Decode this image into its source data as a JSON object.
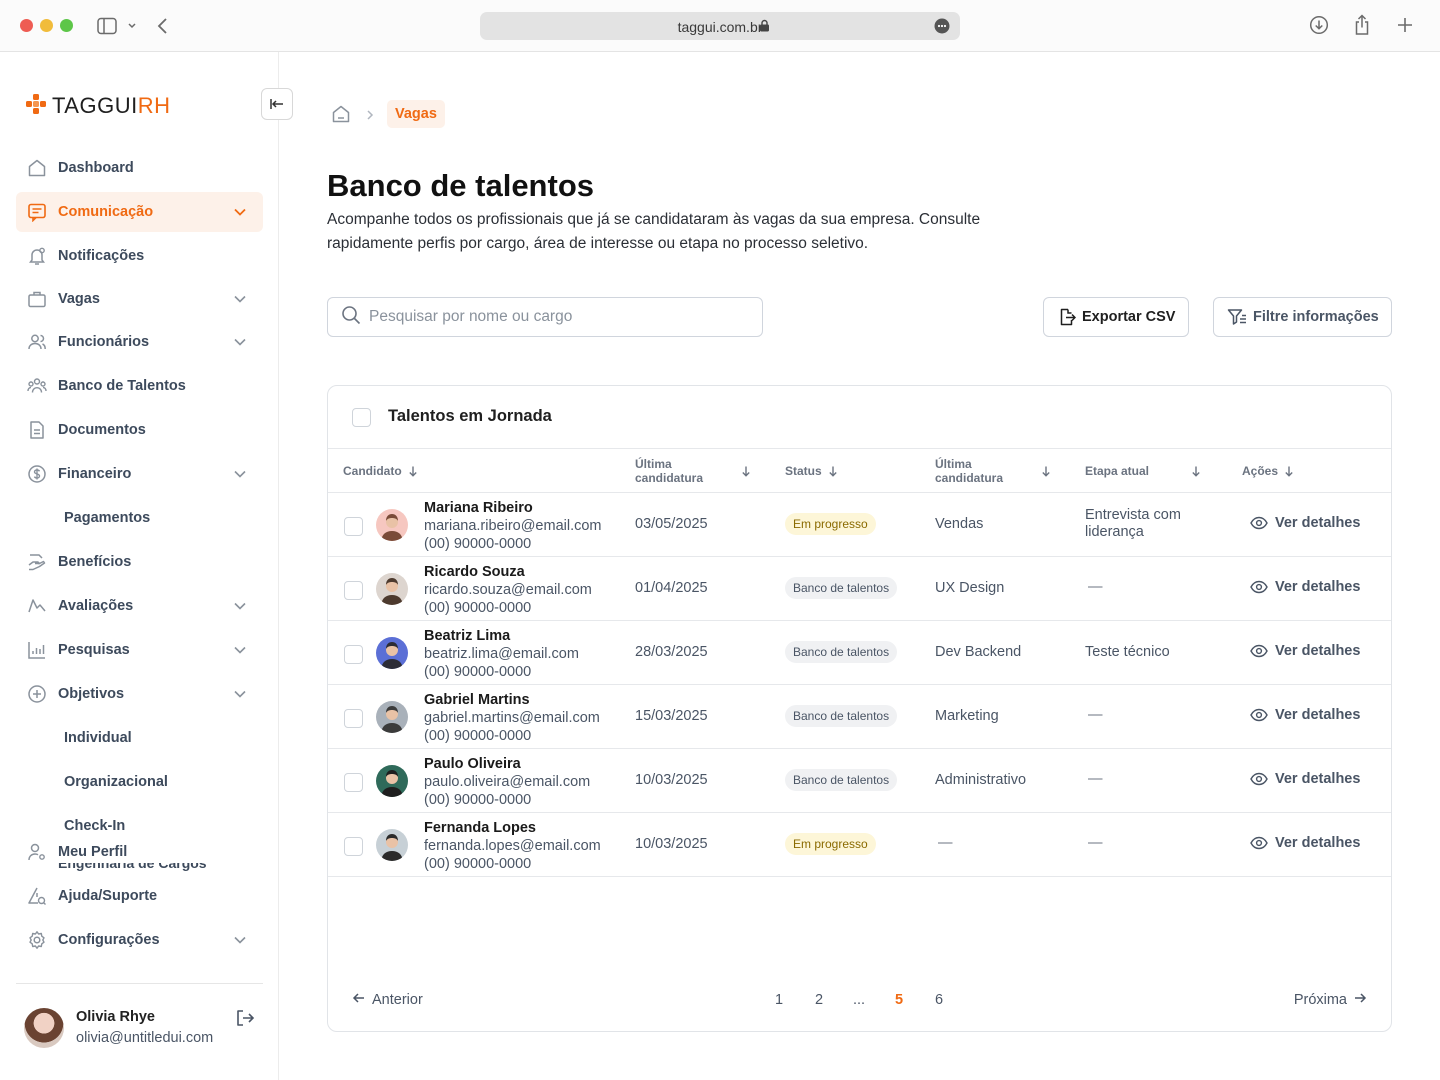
{
  "browser": {
    "url": "taggui.com.br"
  },
  "sidebar": {
    "logo": {
      "text_main": "TAGGUI",
      "text_accent": "RH"
    },
    "items": [
      {
        "label": "Dashboard",
        "icon": "home-icon"
      },
      {
        "label": "Comunicação",
        "icon": "message-icon",
        "active": true
      },
      {
        "label": "Notificações",
        "icon": "bell-icon"
      },
      {
        "label": "Vagas",
        "icon": "briefcase-icon"
      },
      {
        "label": "Funcionários",
        "icon": "users-icon"
      },
      {
        "label": "Banco de Talentos",
        "icon": "talents-icon"
      },
      {
        "label": "Documentos",
        "icon": "document-icon"
      },
      {
        "label": "Financeiro",
        "icon": "dollar-icon"
      },
      {
        "label": "Benefícios",
        "icon": "benefits-icon"
      },
      {
        "label": "Avaliações",
        "icon": "evaluation-icon"
      },
      {
        "label": "Pesquisas",
        "icon": "chart-icon"
      },
      {
        "label": "Objetivos",
        "icon": "target-icon"
      },
      {
        "label": "Meu Perfil",
        "icon": "profile-icon"
      },
      {
        "label": "Ajuda/Suporte",
        "icon": "help-icon"
      },
      {
        "label": "Configurações",
        "icon": "settings-icon"
      }
    ],
    "sub_items": {
      "pagamentos": "Pagamentos",
      "individual": "Individual",
      "organizacional": "Organizacional",
      "checkin": "Check-In"
    },
    "hidden_label": "Engenharia de Cargos",
    "user": {
      "name": "Olivia Rhye",
      "email": "olivia@untitledui.com"
    }
  },
  "breadcrumb": {
    "current": "Vagas"
  },
  "page": {
    "title": "Banco de talentos",
    "description": "Acompanhe todos os profissionais que já se candidataram às vagas da sua empresa. Consulte rapidamente perfis por cargo, área de interesse ou etapa no processo seletivo."
  },
  "search": {
    "placeholder": "Pesquisar por nome ou cargo"
  },
  "toolbar": {
    "export_label": "Exportar CSV",
    "filter_label": "Filtre informações"
  },
  "table": {
    "title": "Talentos em Jornada",
    "columns": {
      "candidate": "Candidato",
      "last_application": "Última candidatura",
      "status": "Status",
      "last_application_2": "Última candidatura",
      "stage": "Etapa atual",
      "actions": "Ações"
    },
    "action_label": "Ver detalhes",
    "rows": [
      {
        "name": "Mariana Ribeiro",
        "email": "mariana.ribeiro@email.com",
        "phone": "(00) 90000-0000",
        "date": "03/05/2025",
        "status": "Em progresso",
        "status_type": "progress",
        "area": "Vendas",
        "stage": "Entrevista com liderança"
      },
      {
        "name": "Ricardo Souza",
        "email": "ricardo.souza@email.com",
        "phone": "(00) 90000-0000",
        "date": "01/04/2025",
        "status": "Banco de talentos",
        "status_type": "bank",
        "area": "UX Design",
        "stage": "—"
      },
      {
        "name": "Beatriz Lima",
        "email": "beatriz.lima@email.com",
        "phone": "(00) 90000-0000",
        "date": "28/03/2025",
        "status": "Banco de talentos",
        "status_type": "bank",
        "area": "Dev Backend",
        "stage": "Teste técnico"
      },
      {
        "name": "Gabriel Martins",
        "email": "gabriel.martins@email.com",
        "phone": "(00) 90000-0000",
        "date": "15/03/2025",
        "status": "Banco de talentos",
        "status_type": "bank",
        "area": "Marketing",
        "stage": "—"
      },
      {
        "name": "Paulo Oliveira",
        "email": "paulo.oliveira@email.com",
        "phone": "(00) 90000-0000",
        "date": "10/03/2025",
        "status": "Banco de talentos",
        "status_type": "bank",
        "area": "Administrativo",
        "stage": "—"
      },
      {
        "name": "Fernanda Lopes",
        "email": "fernanda.lopes@email.com",
        "phone": "(00) 90000-0000",
        "date": "10/03/2025",
        "status": "Em progresso",
        "status_type": "progress",
        "area": "—",
        "stage": "—"
      }
    ]
  },
  "pagination": {
    "prev": "Anterior",
    "next": "Próxima",
    "pages": [
      "1",
      "2",
      "...",
      "5",
      "6"
    ],
    "current": "5"
  },
  "colors": {
    "accent": "#f06a13",
    "accent_bg": "#fdf1e9",
    "progress_bg": "#fdf6d8",
    "bank_bg": "#f0f1f3"
  }
}
